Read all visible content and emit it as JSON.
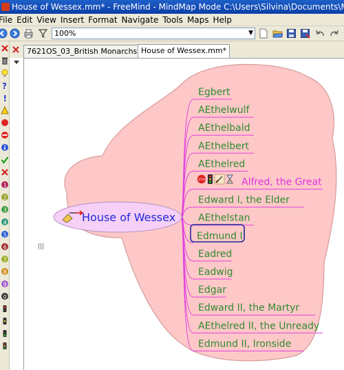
{
  "window": {
    "title": "House of Wessex.mm* - FreeMind - MindMap Mode C:\\Users\\Silvina\\Documents\\Mindmapping"
  },
  "menu": [
    "File",
    "Edit",
    "View",
    "Insert",
    "Format",
    "Navigate",
    "Tools",
    "Maps",
    "Help"
  ],
  "toolbar": {
    "zoom_value": "100%"
  },
  "tabs": [
    {
      "label": "7621OS_03_British Monarchs.mm*"
    },
    {
      "label": "House of Wessex.mm*"
    }
  ],
  "root": {
    "label": "House of Wessex",
    "icon": "broom-arrow-icon"
  },
  "children": [
    {
      "label": "Egbert"
    },
    {
      "label": "AEthelwulf"
    },
    {
      "label": "AEthelbald"
    },
    {
      "label": "AEthelbert"
    },
    {
      "label": "AEthelred"
    },
    {
      "label": "Alfred, the Great",
      "icons": [
        "stop-icon",
        "traffic-light-icon",
        "knife-icon",
        "hourglass-icon"
      ]
    },
    {
      "label": "Edward I, the Elder"
    },
    {
      "label": "AEthelstan"
    },
    {
      "label": "Edmund I"
    },
    {
      "label": "Eadred"
    },
    {
      "label": "Eadwig"
    },
    {
      "label": "Edgar"
    },
    {
      "label": "Edward II, the Martyr"
    },
    {
      "label": "AEthelred II, the Unready"
    },
    {
      "label": "Edmund II, Ironside"
    }
  ],
  "colors": {
    "cloud_fill": "#ffc8c8",
    "cloud_stroke": "#d59a9a",
    "edge": "#e040e0",
    "node_text": "#2e8b2e",
    "alfred_text": "#e030e0",
    "root_text": "#1e2ad8",
    "root_fill": "#f6d0f6",
    "selected_border": "#1b2a9a"
  }
}
